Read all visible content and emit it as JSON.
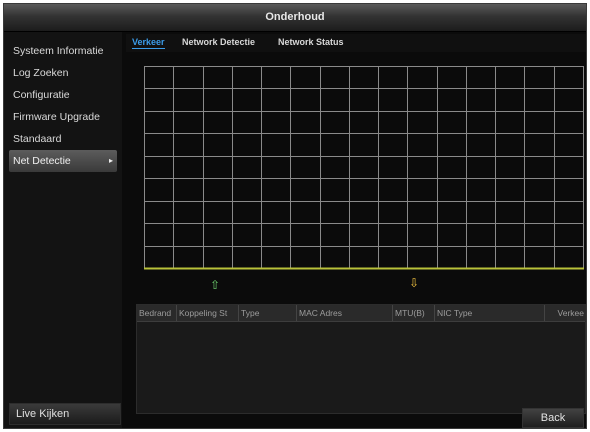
{
  "window": {
    "title": "Onderhoud"
  },
  "sidebar": {
    "items": [
      {
        "label": "Systeem Informatie"
      },
      {
        "label": "Log Zoeken"
      },
      {
        "label": "Configuratie"
      },
      {
        "label": "Firmware Upgrade"
      },
      {
        "label": "Standaard"
      },
      {
        "label": "Net Detectie",
        "active": true,
        "arrow": "▸"
      }
    ],
    "live_button": "Live Kijken"
  },
  "tabs": [
    {
      "label": "Verkeer",
      "active": true
    },
    {
      "label": "Network Detectie"
    },
    {
      "label": "Network Status"
    }
  ],
  "graph": {
    "grid_color": "#8a8a8a",
    "baseline_color": "#b9c23a",
    "upload_indicator": "⇧",
    "download_indicator": "⇩",
    "upload_color": "#6fd06f",
    "download_color": "#f0c040"
  },
  "table": {
    "columns": [
      "Bedrand",
      "Koppeling St",
      "Type",
      "MAC Adres",
      "MTU(B)",
      "NIC Type",
      "Verkee"
    ]
  },
  "footer": {
    "back_button": "Back"
  }
}
